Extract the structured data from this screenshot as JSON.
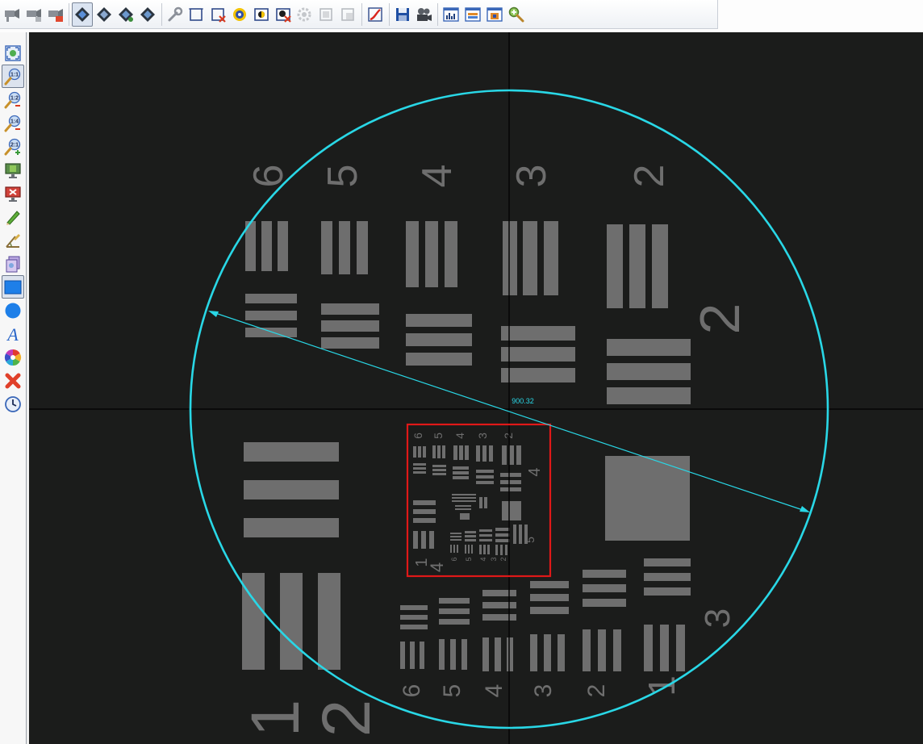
{
  "toolbar": {
    "tools": [
      {
        "name": "camera-connect-icon"
      },
      {
        "name": "camera-disconnect-icon"
      },
      {
        "name": "camera-settings-icon"
      },
      {
        "name": "live-video-icon",
        "active": true
      },
      {
        "name": "video-pause-icon"
      },
      {
        "name": "video-next-icon"
      },
      {
        "name": "video-capture-icon"
      },
      {
        "name": "wrench-settings-icon"
      },
      {
        "name": "roi-select-icon"
      },
      {
        "name": "roi-clear-icon"
      },
      {
        "name": "white-balance-icon"
      },
      {
        "name": "exposure-icon"
      },
      {
        "name": "exposure-clear-icon"
      },
      {
        "name": "gear-disabled-icon"
      },
      {
        "name": "frame-disabled-icon"
      },
      {
        "name": "frame-disabled-2-icon"
      },
      {
        "name": "curve-adjust-icon"
      },
      {
        "name": "save-icon"
      },
      {
        "name": "film-record-icon"
      },
      {
        "name": "histogram-icon"
      },
      {
        "name": "panel-view-icon"
      },
      {
        "name": "fit-window-icon"
      },
      {
        "name": "zoom-in-icon"
      }
    ]
  },
  "sidebar": {
    "tools": [
      {
        "name": "zoom-fit-icon"
      },
      {
        "name": "zoom-1-1-icon",
        "label": "1:1",
        "active": true
      },
      {
        "name": "zoom-1-2-icon",
        "label": "1:2"
      },
      {
        "name": "zoom-1-4-icon",
        "label": "1:4"
      },
      {
        "name": "zoom-2-1-icon",
        "label": "2:1"
      },
      {
        "name": "fullscreen-icon"
      },
      {
        "name": "fullscreen-exit-icon"
      },
      {
        "name": "pencil-icon"
      },
      {
        "name": "measure-angle-icon"
      },
      {
        "name": "layer-icon"
      },
      {
        "name": "rectangle-tool-icon",
        "active": true
      },
      {
        "name": "circle-tool-icon"
      },
      {
        "name": "text-tool-icon",
        "label": "A"
      },
      {
        "name": "color-wheel-icon"
      },
      {
        "name": "delete-annotations-icon"
      },
      {
        "name": "clock-icon"
      }
    ]
  },
  "viewport": {
    "measurement_label": "900.32",
    "target_group_numbers_right": [
      "2",
      "3"
    ],
    "target_top_row_numbers": [
      "6",
      "5",
      "4",
      "3",
      "2"
    ],
    "target_bottom_row_numbers": [
      "6",
      "5",
      "4",
      "3",
      "2",
      "1"
    ],
    "target_group_numbers_large": [
      "1",
      "2"
    ],
    "inner_group_numbers_top": [
      "6",
      "5",
      "4",
      "3",
      "2"
    ],
    "inner_group_numbers_side": [
      "4",
      "5"
    ],
    "inner_group_numbers_bottom": [
      "1",
      "4"
    ],
    "inner_bottom_small_numbers": [
      "6",
      "5",
      "4",
      "3",
      "2"
    ],
    "colors": {
      "background": "#1b1c1b",
      "target_pattern": "#6e6e6e",
      "crosshair": "#050505",
      "measurement": "#29d7e6",
      "roi_box": "#e01818"
    }
  }
}
